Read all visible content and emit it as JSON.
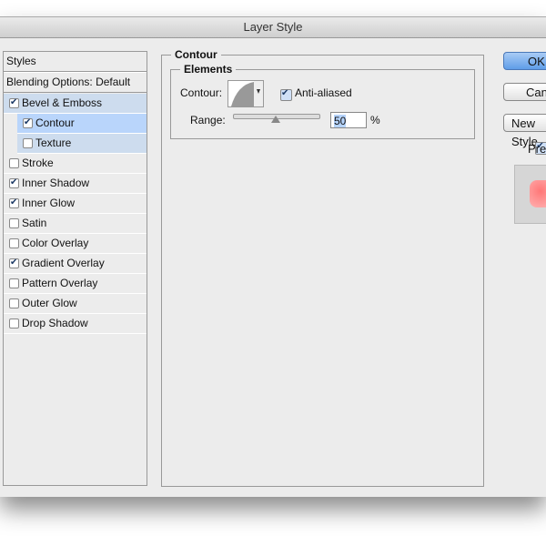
{
  "window": {
    "title": "Layer Style"
  },
  "sidebar": {
    "header": "Styles",
    "blending": "Blending Options: Default",
    "items": [
      {
        "label": "Bevel & Emboss",
        "checked": true
      },
      {
        "label": "Contour",
        "checked": true
      },
      {
        "label": "Texture",
        "checked": false
      },
      {
        "label": "Stroke",
        "checked": false
      },
      {
        "label": "Inner Shadow",
        "checked": true
      },
      {
        "label": "Inner Glow",
        "checked": true
      },
      {
        "label": "Satin",
        "checked": false
      },
      {
        "label": "Color Overlay",
        "checked": false
      },
      {
        "label": "Gradient Overlay",
        "checked": true
      },
      {
        "label": "Pattern Overlay",
        "checked": false
      },
      {
        "label": "Outer Glow",
        "checked": false
      },
      {
        "label": "Drop Shadow",
        "checked": false
      }
    ]
  },
  "panel": {
    "title": "Contour",
    "group": "Elements",
    "contour_label": "Contour:",
    "antialiased_label": "Anti-aliased",
    "antialiased": true,
    "range_label": "Range:",
    "range_value": "50",
    "range_unit": "%",
    "range_percent": 50
  },
  "buttons": {
    "ok": "OK",
    "cancel": "Cancel",
    "new_style": "New Style...",
    "preview": "Preview",
    "preview_checked": true
  }
}
